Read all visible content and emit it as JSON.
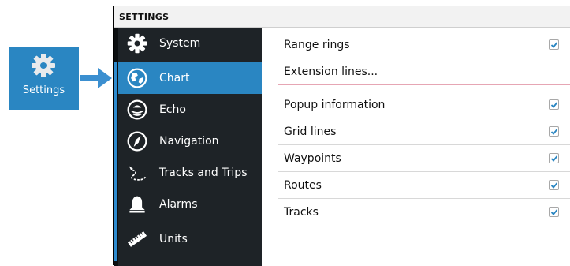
{
  "launcher": {
    "label": "Settings",
    "icon": "gear-icon",
    "color": "#2a86c2"
  },
  "panel": {
    "title": "SETTINGS"
  },
  "sidebar": {
    "items": [
      {
        "label": "System",
        "icon": "gear-icon"
      },
      {
        "label": "Chart",
        "icon": "chart-icon",
        "selected": true
      },
      {
        "label": "Echo",
        "icon": "echo-icon"
      },
      {
        "label": "Navigation",
        "icon": "compass-icon"
      },
      {
        "label": "Tracks and Trips",
        "icon": "tracks-icon"
      },
      {
        "label": "Alarms",
        "icon": "bell-icon"
      },
      {
        "label": "Units",
        "icon": "ruler-icon"
      }
    ]
  },
  "content": {
    "rows": [
      {
        "label": "Range rings",
        "checked": true
      },
      {
        "label": "Extension lines...",
        "checked": null
      },
      {
        "label": "Popup information",
        "checked": true
      },
      {
        "label": "Grid lines",
        "checked": true
      },
      {
        "label": "Waypoints",
        "checked": true
      },
      {
        "label": "Routes",
        "checked": true
      },
      {
        "label": "Tracks",
        "checked": true
      }
    ]
  },
  "colors": {
    "accent": "#2a86c2",
    "sidebar_bg": "#1e2327",
    "check": "#2a86c2"
  }
}
